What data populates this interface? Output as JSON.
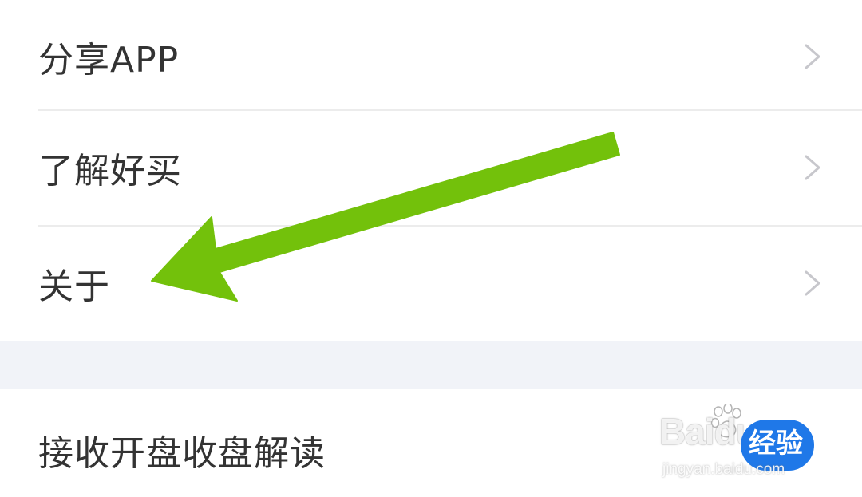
{
  "menu": {
    "items": [
      {
        "label": "分享APP"
      },
      {
        "label": "了解好买"
      },
      {
        "label": "关于"
      }
    ]
  },
  "second_group": {
    "items": [
      {
        "label": "接收开盘收盘解读"
      }
    ]
  },
  "annotation": {
    "arrow_color": "#73c10b",
    "arrow_target": "关于"
  },
  "watermark": {
    "logo_text": "Baidu",
    "badge_text": "经验",
    "url": "jingyan.baidu.com"
  },
  "colors": {
    "text": "#333333",
    "chevron": "#c7c7cc",
    "divider": "#ececec",
    "section_gap": "#f1f3f8",
    "badge": "#1f78e8"
  },
  "icons": [
    "chevron-right-icon",
    "arrow-annotation",
    "baidu-paw-icon"
  ]
}
